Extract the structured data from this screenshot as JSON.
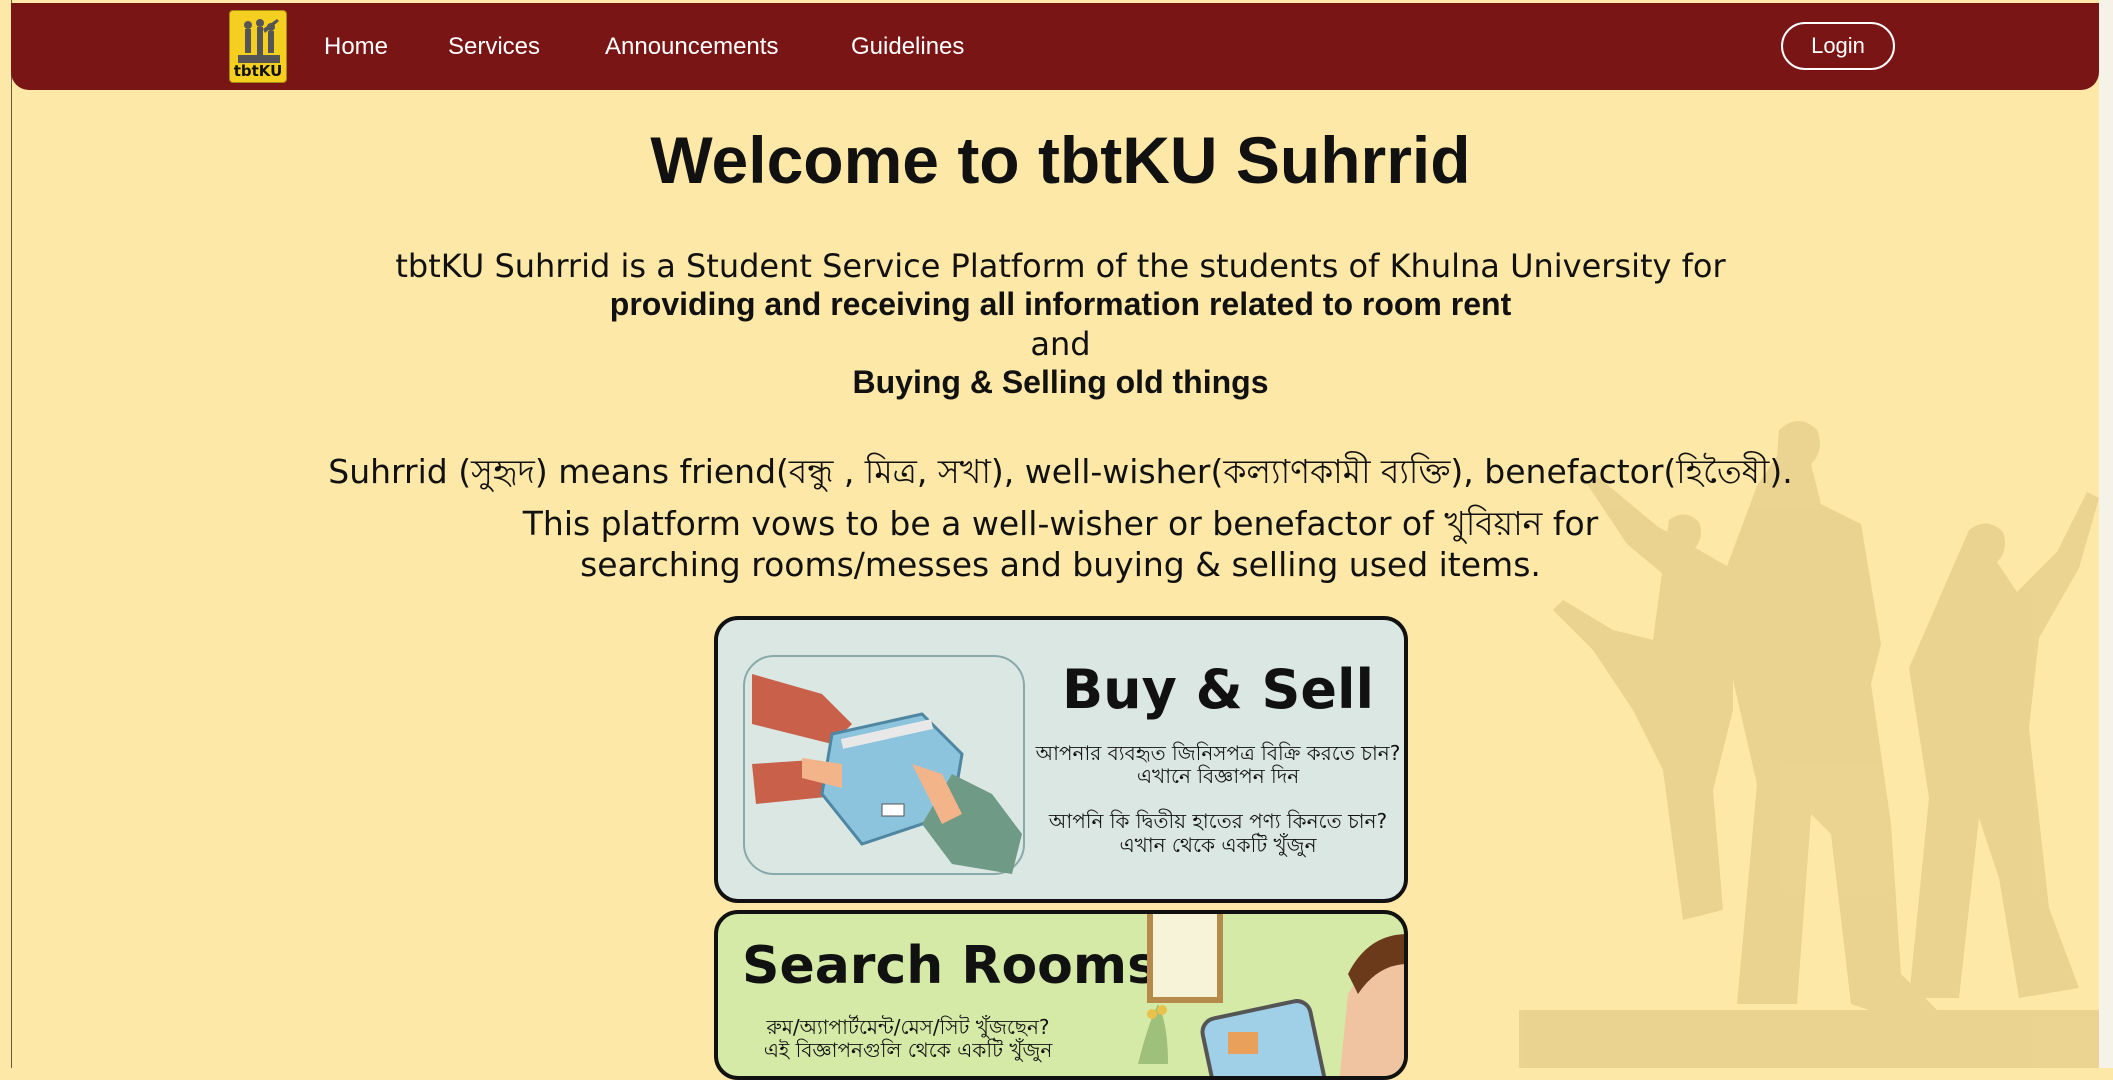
{
  "nav": {
    "logo_text": "tbtKU",
    "links": [
      "Home",
      "Services",
      "Announcements",
      "Guidelines"
    ],
    "login_label": "Login"
  },
  "hero": {
    "title": "Welcome to tbtKU Suhrrid",
    "intro_line1": "tbtKU Suhrrid is a Student Service Platform of the students of Khulna University for",
    "intro_line2": "providing and receiving all information related to room rent",
    "intro_line3": "and",
    "intro_line4": "Buying & Selling old things",
    "meaning_line1": "Suhrrid (সুহৃদ) means friend(বন্ধু , মিত্র, সখা), well-wisher(কল্যাণকামী ব্যক্তি), benefactor(হিতৈষী).",
    "meaning_line2": "This platform vows to be a well-wisher or benefactor of খুবিয়ান for",
    "meaning_line3": "searching rooms/messes and buying & selling used items."
  },
  "cards": {
    "buy_sell": {
      "title": "Buy & Sell",
      "line1": "আপনার ব্যবহৃত জিনিসপত্র বিক্রি করতে চান?",
      "line2": "এখানে বিজ্ঞাপন দিন",
      "line3": "আপনি কি দ্বিতীয় হাতের পণ্য কিনতে চান?",
      "line4": "এখান থেকে একটি খুঁজুন"
    },
    "search_rooms": {
      "title": "Search Rooms",
      "line1": "রুম/অ্যাপার্টমেন্ট/মেস/সিট খুঁজছেন?",
      "line2": "এই বিজ্ঞাপনগুলি থেকে একটি খুঁজুন"
    }
  },
  "colors": {
    "navbar": "#7a1516",
    "background": "#fde8a8",
    "buy_card": "#dbe7e3",
    "rooms_card": "#d5eaa6"
  }
}
